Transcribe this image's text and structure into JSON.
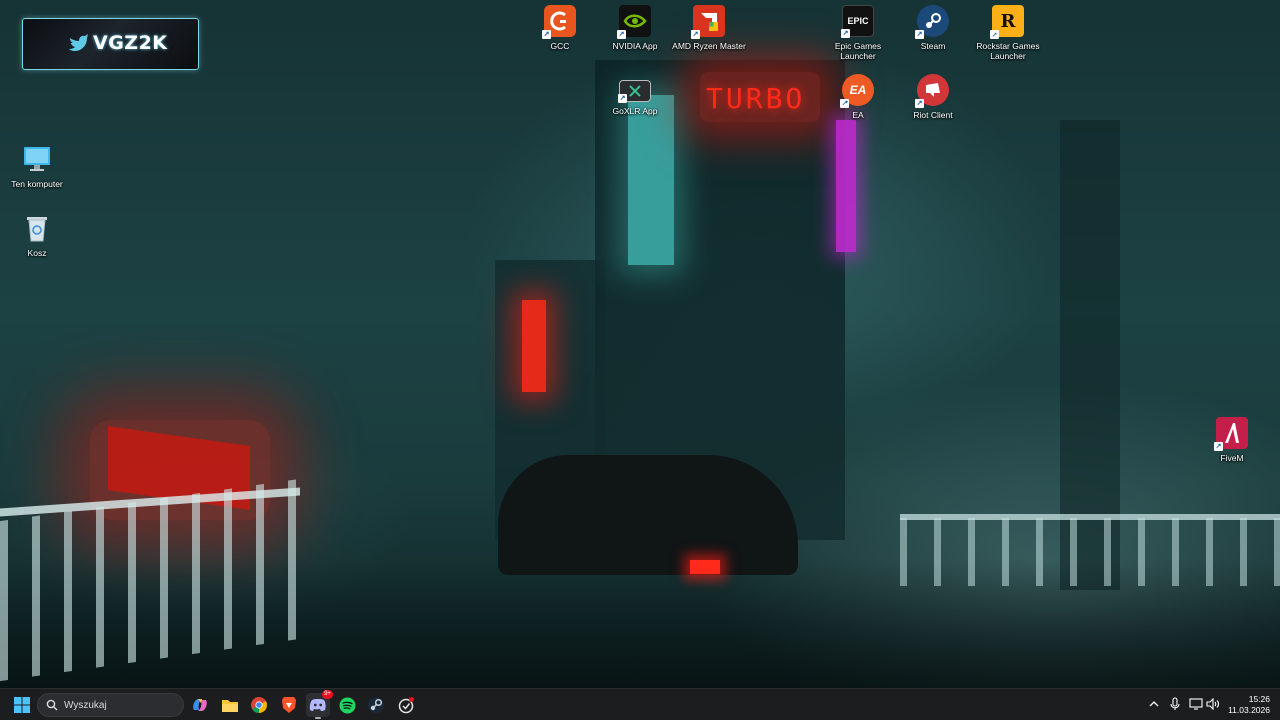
{
  "logo": {
    "text": "VGZ2K"
  },
  "desktop_icons": [
    {
      "label": "Ten komputer",
      "icon": "monitor-icon"
    },
    {
      "label": "Kosz",
      "icon": "recycle-bin-icon"
    },
    {
      "label": "GCC",
      "icon": "gcc-icon",
      "shortcut": true
    },
    {
      "label": "NVIDIA App",
      "icon": "nvidia-icon",
      "shortcut": true
    },
    {
      "label": "AMD Ryzen Master",
      "icon": "amd-ryzen-master-icon",
      "shortcut": true
    },
    {
      "label": "Epic Games Launcher",
      "icon": "epic-games-icon",
      "shortcut": true,
      "glyph": "EPIC"
    },
    {
      "label": "Steam",
      "icon": "steam-icon",
      "shortcut": true
    },
    {
      "label": "Rockstar Games Launcher",
      "icon": "rockstar-icon",
      "shortcut": true,
      "glyph": "R"
    },
    {
      "label": "GoXLR App",
      "icon": "goxlr-icon",
      "shortcut": true
    },
    {
      "label": "EA",
      "icon": "ea-icon",
      "shortcut": true,
      "glyph": "EA"
    },
    {
      "label": "Riot Client",
      "icon": "riot-client-icon",
      "shortcut": true
    },
    {
      "label": "FiveM",
      "icon": "fivem-icon",
      "shortcut": true
    }
  ],
  "wallpaper": {
    "sign_text": "TURBO"
  },
  "taskbar": {
    "search_placeholder": "Wyszukaj",
    "pinned": [
      {
        "name": "start-button",
        "icon": "windows-icon"
      },
      {
        "name": "copilot",
        "icon": "copilot-icon"
      },
      {
        "name": "file-explorer",
        "icon": "folder-icon"
      },
      {
        "name": "chrome",
        "icon": "chrome-icon"
      },
      {
        "name": "brave",
        "icon": "brave-icon"
      },
      {
        "name": "discord",
        "icon": "discord-icon",
        "badge": "9+"
      },
      {
        "name": "spotify",
        "icon": "spotify-icon"
      },
      {
        "name": "steam",
        "icon": "steam-icon"
      },
      {
        "name": "app-alert",
        "icon": "app-alert-icon"
      }
    ],
    "tray": [
      "chevron-up-icon",
      "microphone-icon",
      "display-icon",
      "speaker-icon"
    ],
    "clock": {
      "time": "15:26",
      "date": "11.03.2026"
    }
  },
  "colors": {
    "taskbar_bg": "#1c1d1f",
    "accent_neon_red": "#ff2a1a",
    "accent_neon_cyan": "#3fb3b0",
    "accent_neon_magenta": "#c02ad0"
  }
}
